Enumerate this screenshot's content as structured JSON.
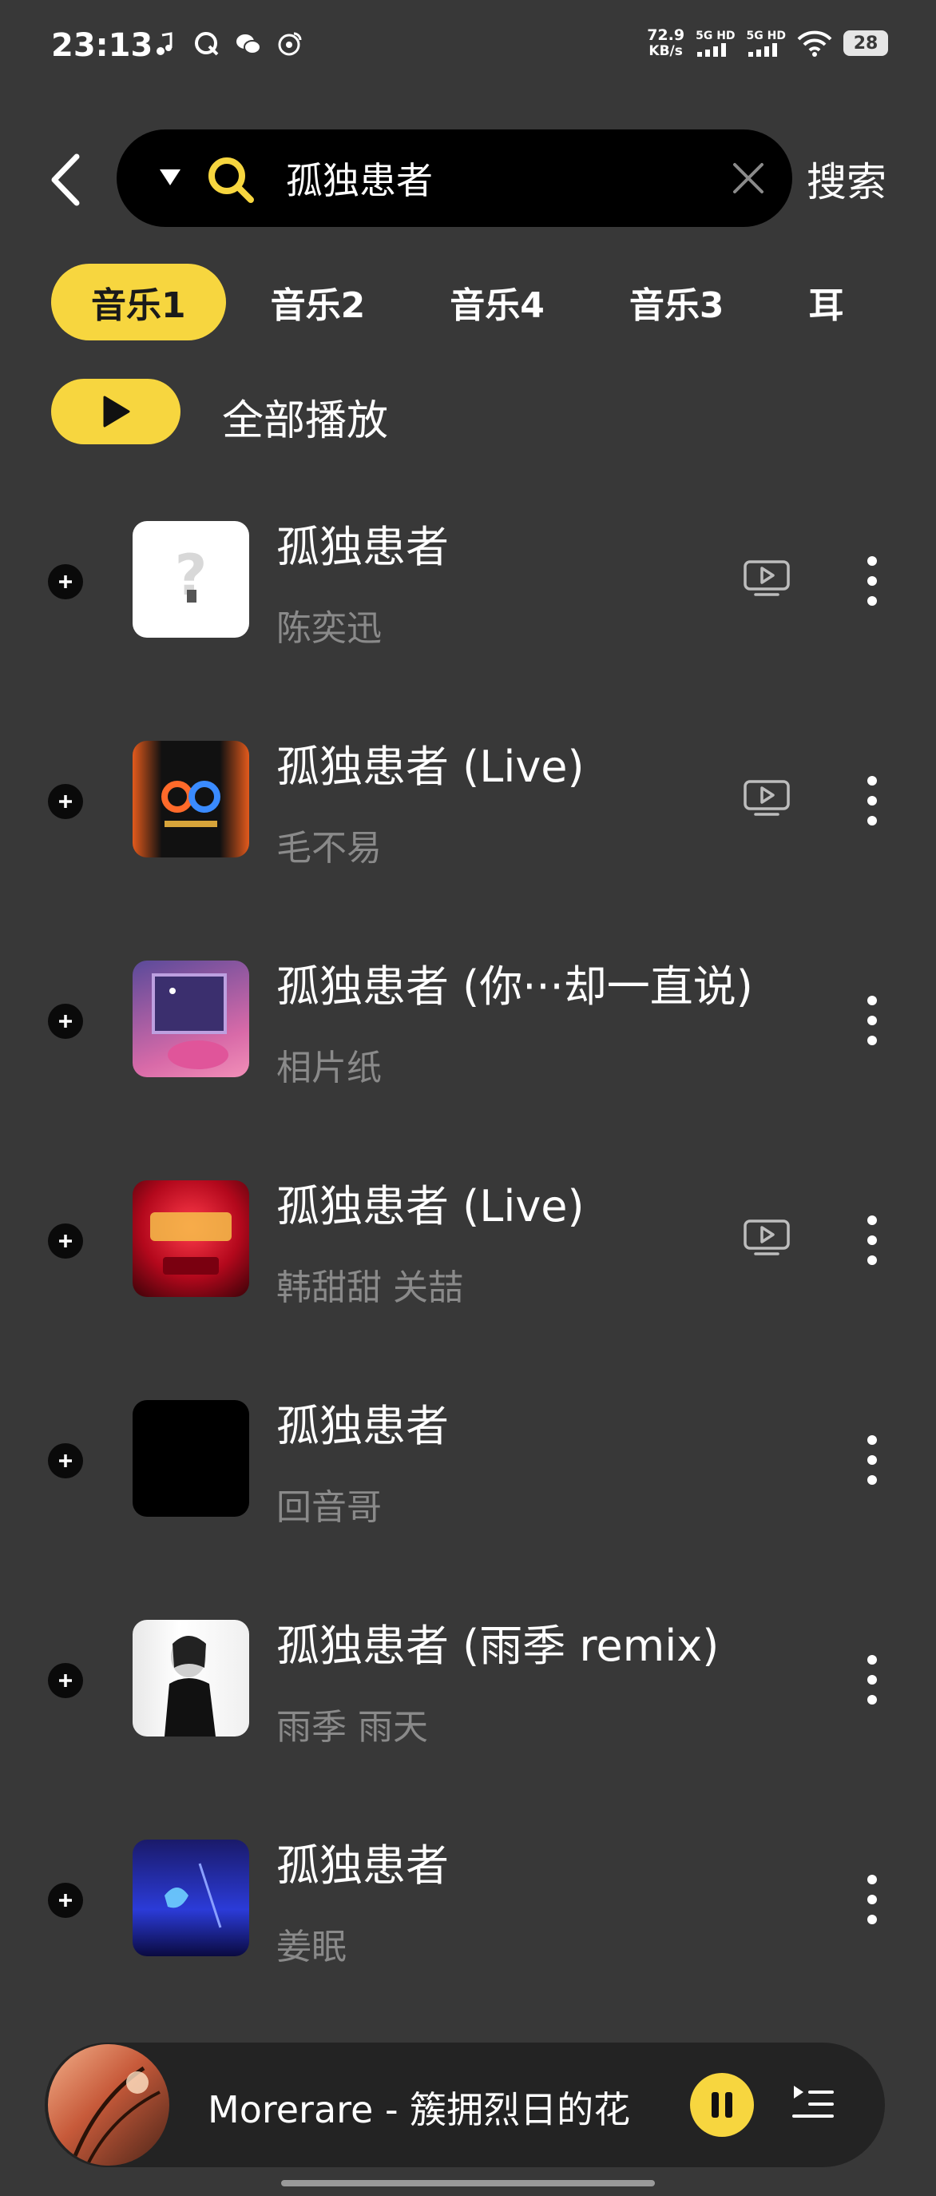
{
  "status_bar": {
    "time": "23:13",
    "net_speed_value": "72.9",
    "net_speed_unit": "KB/s",
    "sim1_label": "5G HD",
    "sim2_label": "5G HD",
    "battery": "28",
    "icons": [
      "music-note-icon",
      "q-app-icon",
      "wechat-icon",
      "weibo-icon",
      "signal-icon",
      "wifi-icon",
      "battery-icon"
    ]
  },
  "search": {
    "query": "孤独患者",
    "button_label": "搜索"
  },
  "tabs": [
    {
      "label": "音乐1",
      "active": true
    },
    {
      "label": "音乐2",
      "active": false
    },
    {
      "label": "音乐4",
      "active": false
    },
    {
      "label": "音乐3",
      "active": false
    },
    {
      "label": "耳",
      "active": false
    }
  ],
  "play_all_label": "全部播放",
  "songs": [
    {
      "title": "孤独患者",
      "artist": "陈奕迅",
      "has_mv": true
    },
    {
      "title": "孤独患者 (Live)",
      "artist": "毛不易",
      "has_mv": true
    },
    {
      "title": "孤独患者 (你···却一直说)",
      "artist": "相片纸",
      "has_mv": false
    },
    {
      "title": "孤独患者 (Live)",
      "artist": "韩甜甜 关喆",
      "has_mv": true
    },
    {
      "title": "孤独患者",
      "artist": "回音哥",
      "has_mv": false
    },
    {
      "title": "孤独患者 (雨季 remix)",
      "artist": "雨季 雨天",
      "has_mv": false
    },
    {
      "title": "孤独患者",
      "artist": "姜眠",
      "has_mv": false
    }
  ],
  "mini_player": {
    "now_playing": "Morerare - 簇拥烈日的花"
  },
  "colors": {
    "background": "#383838",
    "accent": "#f7d63f",
    "secondary_text": "#8a8a8a"
  }
}
